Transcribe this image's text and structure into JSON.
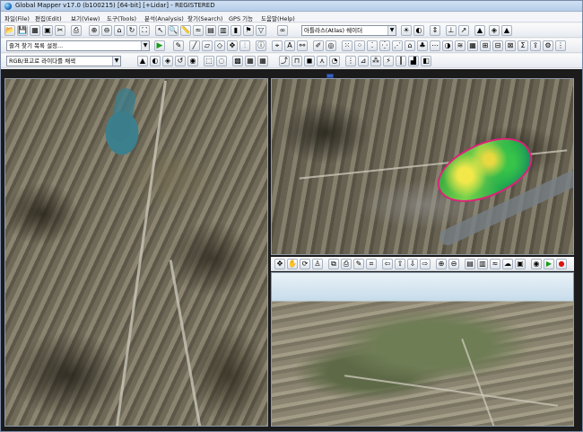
{
  "window": {
    "title": "Global Mapper v17.0 (b100215) [64-bit] [+Lidar] - REGISTERED"
  },
  "menu": [
    "파일(File)",
    "편집(Edit)",
    "보기(View)",
    "도구(Tools)",
    "분석(Analysis)",
    "찾기(Search)",
    "GPS 기능",
    "도움말(Help)"
  ],
  "toolbar": {
    "layer_combo": "아틀라스(Atlas) 쉐이더",
    "favorites_combo": "즐겨 찾기 목록 설정...",
    "render_combo": "RGB/표고로 라이다를 채색"
  },
  "icons": {
    "play": "▶"
  },
  "colors": {
    "lidar_outline": "#e0207a",
    "accent": "#1a6fc0"
  }
}
